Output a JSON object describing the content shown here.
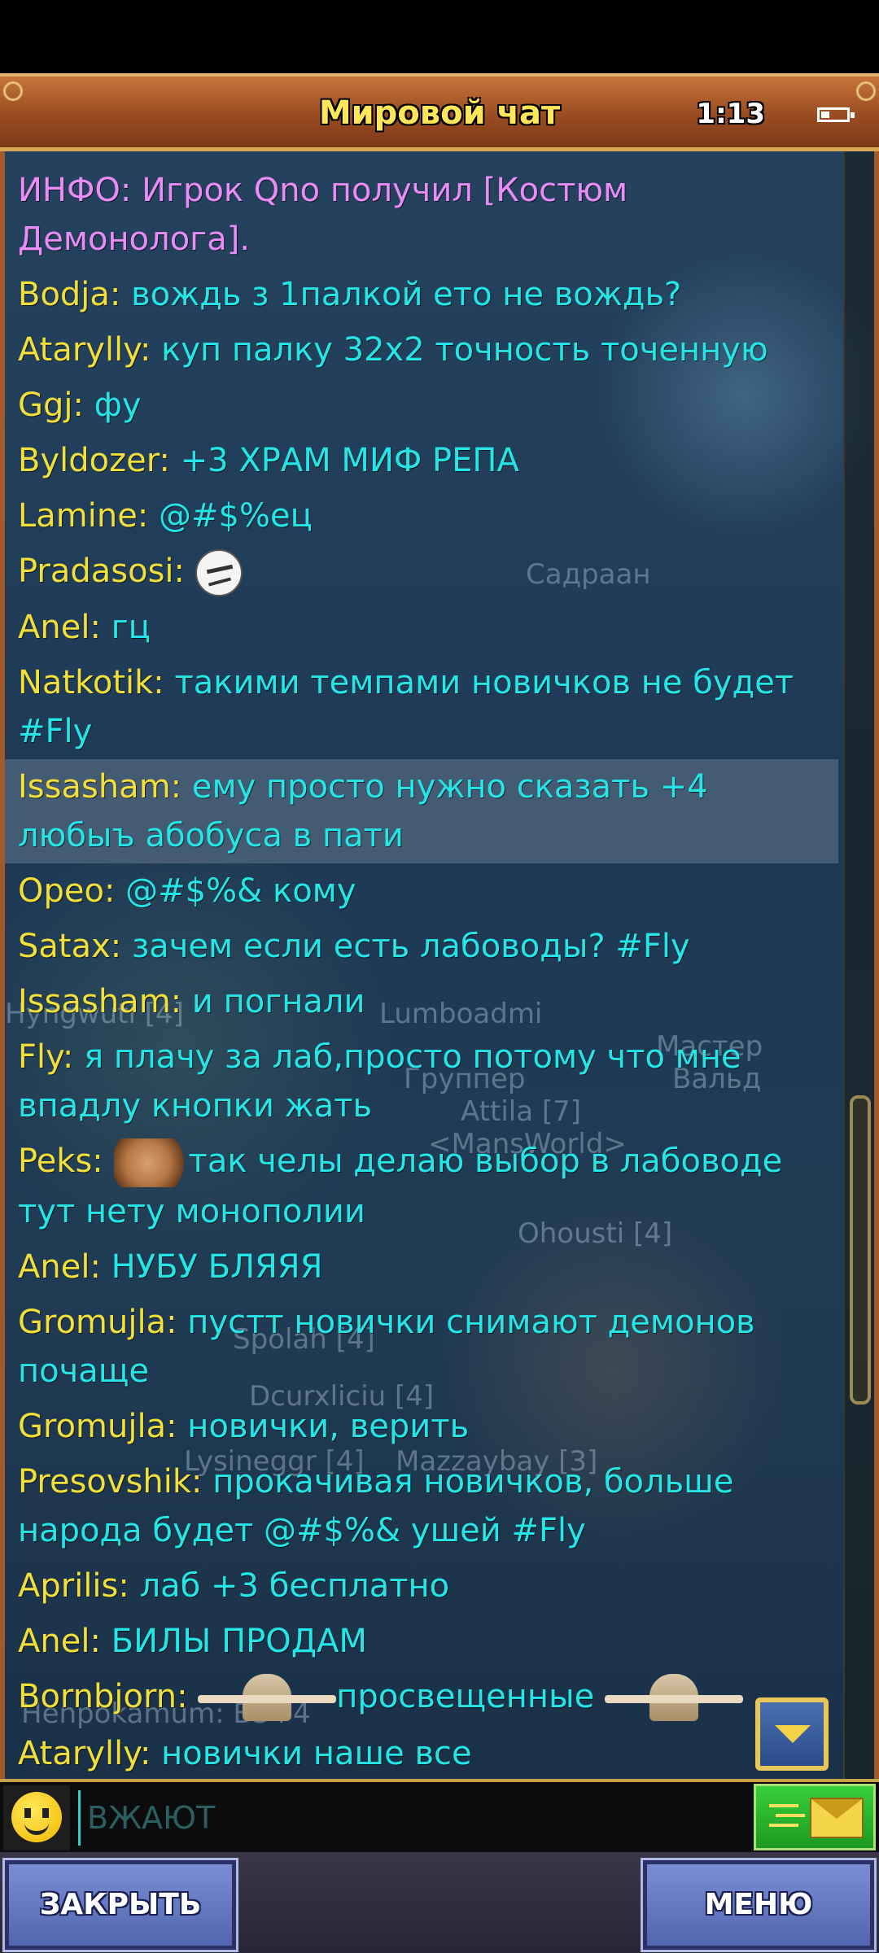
{
  "header": {
    "title": "Мировой чат",
    "clock": "1:13"
  },
  "background_names": [
    "Садраан",
    "Hyngwuti [4]",
    "Lumboadmi",
    "Мастер",
    "Группер",
    "Вальд",
    "Attila [7]",
    "<MansWorld>",
    "Ohousti [4]",
    "Spolah [4]",
    "Dcurxliciu [4]",
    "Lysineggr [4]",
    "Mazzaybay [3]",
    "Henpokamum: Б3+4"
  ],
  "messages": [
    {
      "author": "ИНФО:",
      "text": " Игрок Qno получил ",
      "item": "[Костюм Демонолога]",
      "tail": ".",
      "type": "info"
    },
    {
      "author": "Bodja:",
      "text": " вождь з 1палкой ето не вождь?"
    },
    {
      "author": "Atarylly:",
      "text": " куп палку 32х2 точность точенную"
    },
    {
      "author": "Ggj:",
      "text": " фу"
    },
    {
      "author": "Byldozer:",
      "text": " +3 ХРАМ МИФ РЕПА"
    },
    {
      "author": "Lamine:",
      "text": " @#$%ец"
    },
    {
      "author": "Pradasosi:",
      "text": "",
      "sticker": "poker-face-emoji"
    },
    {
      "author": "Anel:",
      "text": " гц"
    },
    {
      "author": "Natkotik:",
      "text": " такими темпами новичков не будет #Fly"
    },
    {
      "author": "Issasham:",
      "text": " ему просто нужно сказать +4 любыъ абобуса в пати",
      "selected": true
    },
    {
      "author": "Opeo:",
      "text": " @#$%& кому"
    },
    {
      "author": "Satax:",
      "text": " зачем если есть лабоводы? #Fly"
    },
    {
      "author": "Issasham:",
      "text": " и погнали"
    },
    {
      "author": "Fly:",
      "text": " я плачу за лаб,просто потому что мне впадлу кнопки жать"
    },
    {
      "author": "Peks:",
      "text": "так челы делаю выбор в лабоводе тут нету монополии",
      "sticker": "hamster-emoji"
    },
    {
      "author": "Anel:",
      "text": " НУБУ БЛЯЯЯ"
    },
    {
      "author": "Gromujla:",
      "text": " пустт новички снимают демонов почаще"
    },
    {
      "author": "Gromujla:",
      "text": " новички, верить"
    },
    {
      "author": "Presovshik:",
      "text": " прокачивая новичков, больше народа будет @#$%& ушей #Fly"
    },
    {
      "author": "Aprilis:",
      "text": " лаб +3 бесплатно"
    },
    {
      "author": "Anel:",
      "text": " БИЛЫ ПРОДАМ"
    },
    {
      "author": "Bornbjorn:",
      "text": "просвещенные",
      "sticker": "praying-emoji",
      "sticker_after": "praying-emoji"
    },
    {
      "author": "Atarylly:",
      "text": " новички наше все"
    }
  ],
  "input": {
    "placeholder": "ВЖАЮТ"
  },
  "buttons": {
    "close": "ЗАКРЫТЬ",
    "menu": "МЕНЮ"
  },
  "colors": {
    "author": "#f2df3a",
    "message": "#25e6e6",
    "info": "#e98cf6",
    "title": "#ffe55a"
  }
}
